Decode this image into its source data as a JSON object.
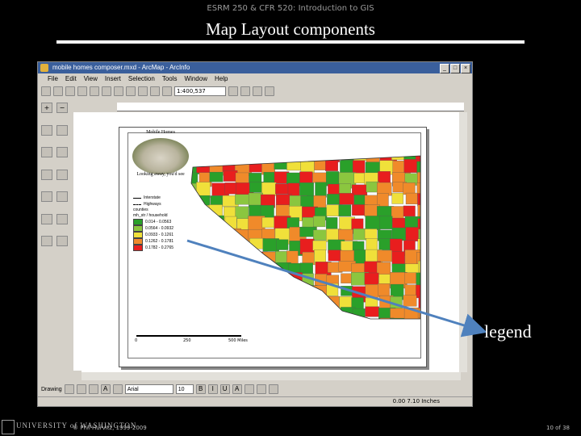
{
  "header": {
    "course": "ESRM 250 & CFR 520: Introduction to GIS",
    "title": "Map Layout components"
  },
  "window": {
    "title": "mobile homes composer.mxd - ArcMap - ArcInfo",
    "buttons": [
      "_",
      "□",
      "×"
    ],
    "menu": [
      "File",
      "Edit",
      "View",
      "Insert",
      "Selection",
      "Tools",
      "Window",
      "Help"
    ],
    "scale_value": "1:400,537",
    "font_name": "Arial",
    "font_size": "10",
    "drawing_label": "Drawing",
    "status_coords": "0.00  7.10 Inches"
  },
  "map": {
    "photo_title": "Mobile Homes",
    "photo_caption": "Looking away, you'd see",
    "legend_items": [
      {
        "label": "Interstate",
        "color": "#000000"
      },
      {
        "label": "Highways",
        "color": "#000000"
      }
    ],
    "legend_heading": "counties",
    "legend_subheading": "mh_str / household",
    "classes": [
      {
        "label": "0.014 - 0.0563",
        "color": "#2aa02a"
      },
      {
        "label": "0.0564 - 0.0932",
        "color": "#8bc63f"
      },
      {
        "label": "0.0933 - 0.1261",
        "color": "#f0e03a"
      },
      {
        "label": "0.1262 - 0.1781",
        "color": "#f08a2a"
      },
      {
        "label": "0.1782 - 0.2765",
        "color": "#e81e1e"
      }
    ],
    "scale_labels": [
      "0",
      "250",
      "500 Miles"
    ],
    "colors": {
      "red": "#e81e1e",
      "orange": "#f08a2a",
      "yellow": "#f0e03a",
      "lightgreen": "#8bc63f",
      "green": "#2aa02a",
      "water": "#ffffff"
    }
  },
  "callout": {
    "label": "legend",
    "arrow_color": "#4f81bd"
  },
  "footer": {
    "logo_text": "UNIVERSITY of WASHINGTON",
    "copyright": "© Phil Hurvitz, 1999-2009",
    "page": "10 of 38"
  }
}
